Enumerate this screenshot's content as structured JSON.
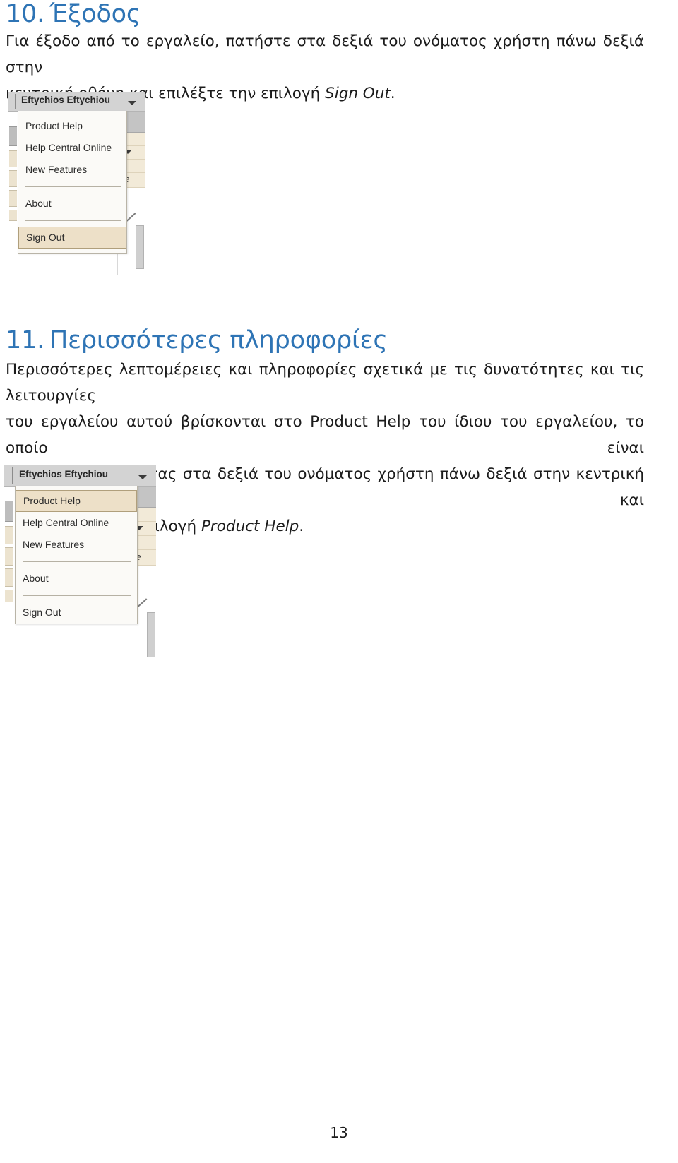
{
  "page": {
    "number": "13"
  },
  "sections": [
    {
      "number": "10.",
      "title": "Έξοδος",
      "paragraph_line_1": "Για έξοδο από το εργαλείο, πατήστε στα δεξιά του ονόματος χρήστη πάνω δεξιά στην",
      "paragraph_line_2_prefix": "κεντρική οθόνη και επιλέξτε την επιλογή ",
      "paragraph_line_2_italic": "Sign Out",
      "paragraph_line_2_suffix": "."
    },
    {
      "number": "11.",
      "title": "Περισσότερες πληροφορίες",
      "paragraph_line_1": "Περισσότερες λεπτομέρειες και πληροφορίες σχετικά με τις δυνατότητες και τις λειτουργίες",
      "paragraph_line_2": "του εργαλείου αυτού βρίσκονται στο Product Help του ίδιου του εργαλείου, το οποίο είναι",
      "paragraph_line_3": "προσβάσιμο πατόντας στα δεξιά του ονόματος χρήστη πάνω δεξιά στην κεντρική οθόνη και",
      "paragraph_line_4_prefix": "επιλέγοντας την επιλογή ",
      "paragraph_line_4_italic": "Product Help",
      "paragraph_line_4_suffix": "."
    }
  ],
  "figures": [
    {
      "id": "signout-menu",
      "user_name": "Eftychios Eftychiou",
      "menu_items": [
        {
          "label": "Product Help",
          "selected": false
        },
        {
          "label": "Help Central Online",
          "selected": false
        },
        {
          "label": "New Features",
          "selected": false
        },
        {
          "label": "About",
          "selected": false
        },
        {
          "label": "Sign Out",
          "selected": true
        }
      ]
    },
    {
      "id": "product-help-menu",
      "user_name": "Eftychios Eftychiou",
      "menu_items": [
        {
          "label": "Product Help",
          "selected": true
        },
        {
          "label": "Help Central Online",
          "selected": false
        },
        {
          "label": "New Features",
          "selected": false
        },
        {
          "label": "About",
          "selected": false
        },
        {
          "label": "Sign Out",
          "selected": false
        }
      ]
    }
  ],
  "colors": {
    "heading": "#2e74b5",
    "body_text": "#1c1c1c",
    "toolbar": "#d3d3d3",
    "menu_background": "#fbfaf7",
    "menu_highlight": "#ede0c8",
    "menu_highlight_border": "#b09f7c",
    "menu_border": "#b9b4a7"
  },
  "background_fragments": {
    "right_glyph_paren": ")",
    "right_glyph_ge": "ge"
  }
}
